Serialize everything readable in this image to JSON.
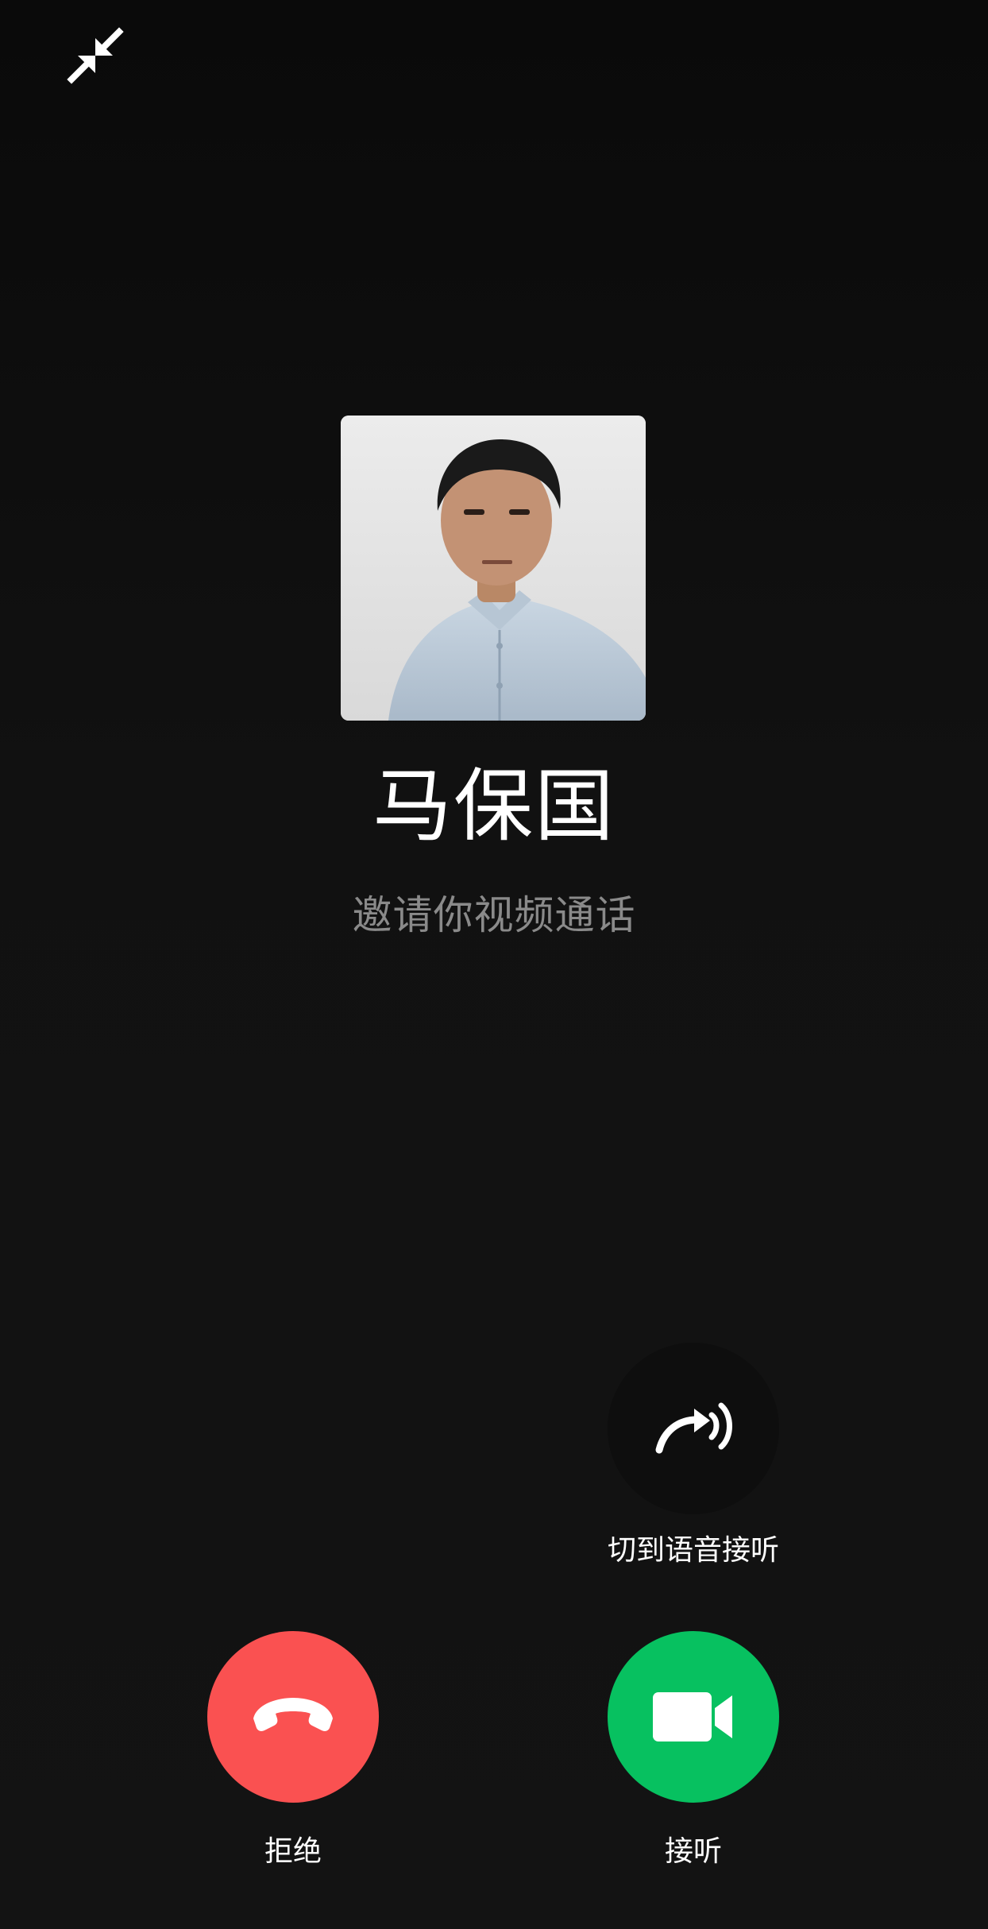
{
  "caller": {
    "name": "马保国",
    "status": "邀请你视频通话"
  },
  "top_bar": {
    "minimize_icon": "minimize-arrows-icon"
  },
  "actions": {
    "switch_voice": {
      "label": "切到语音接听",
      "icon": "voice-switch-icon",
      "color": "#0e0e0e"
    },
    "decline": {
      "label": "拒绝",
      "icon": "hang-up-phone-icon",
      "color": "#fa5151"
    },
    "accept": {
      "label": "接听",
      "icon": "video-camera-icon",
      "color": "#07c160"
    }
  },
  "theme": {
    "background": "#121212",
    "text_primary": "#ffffff",
    "text_secondary": "#8a8a8a"
  }
}
